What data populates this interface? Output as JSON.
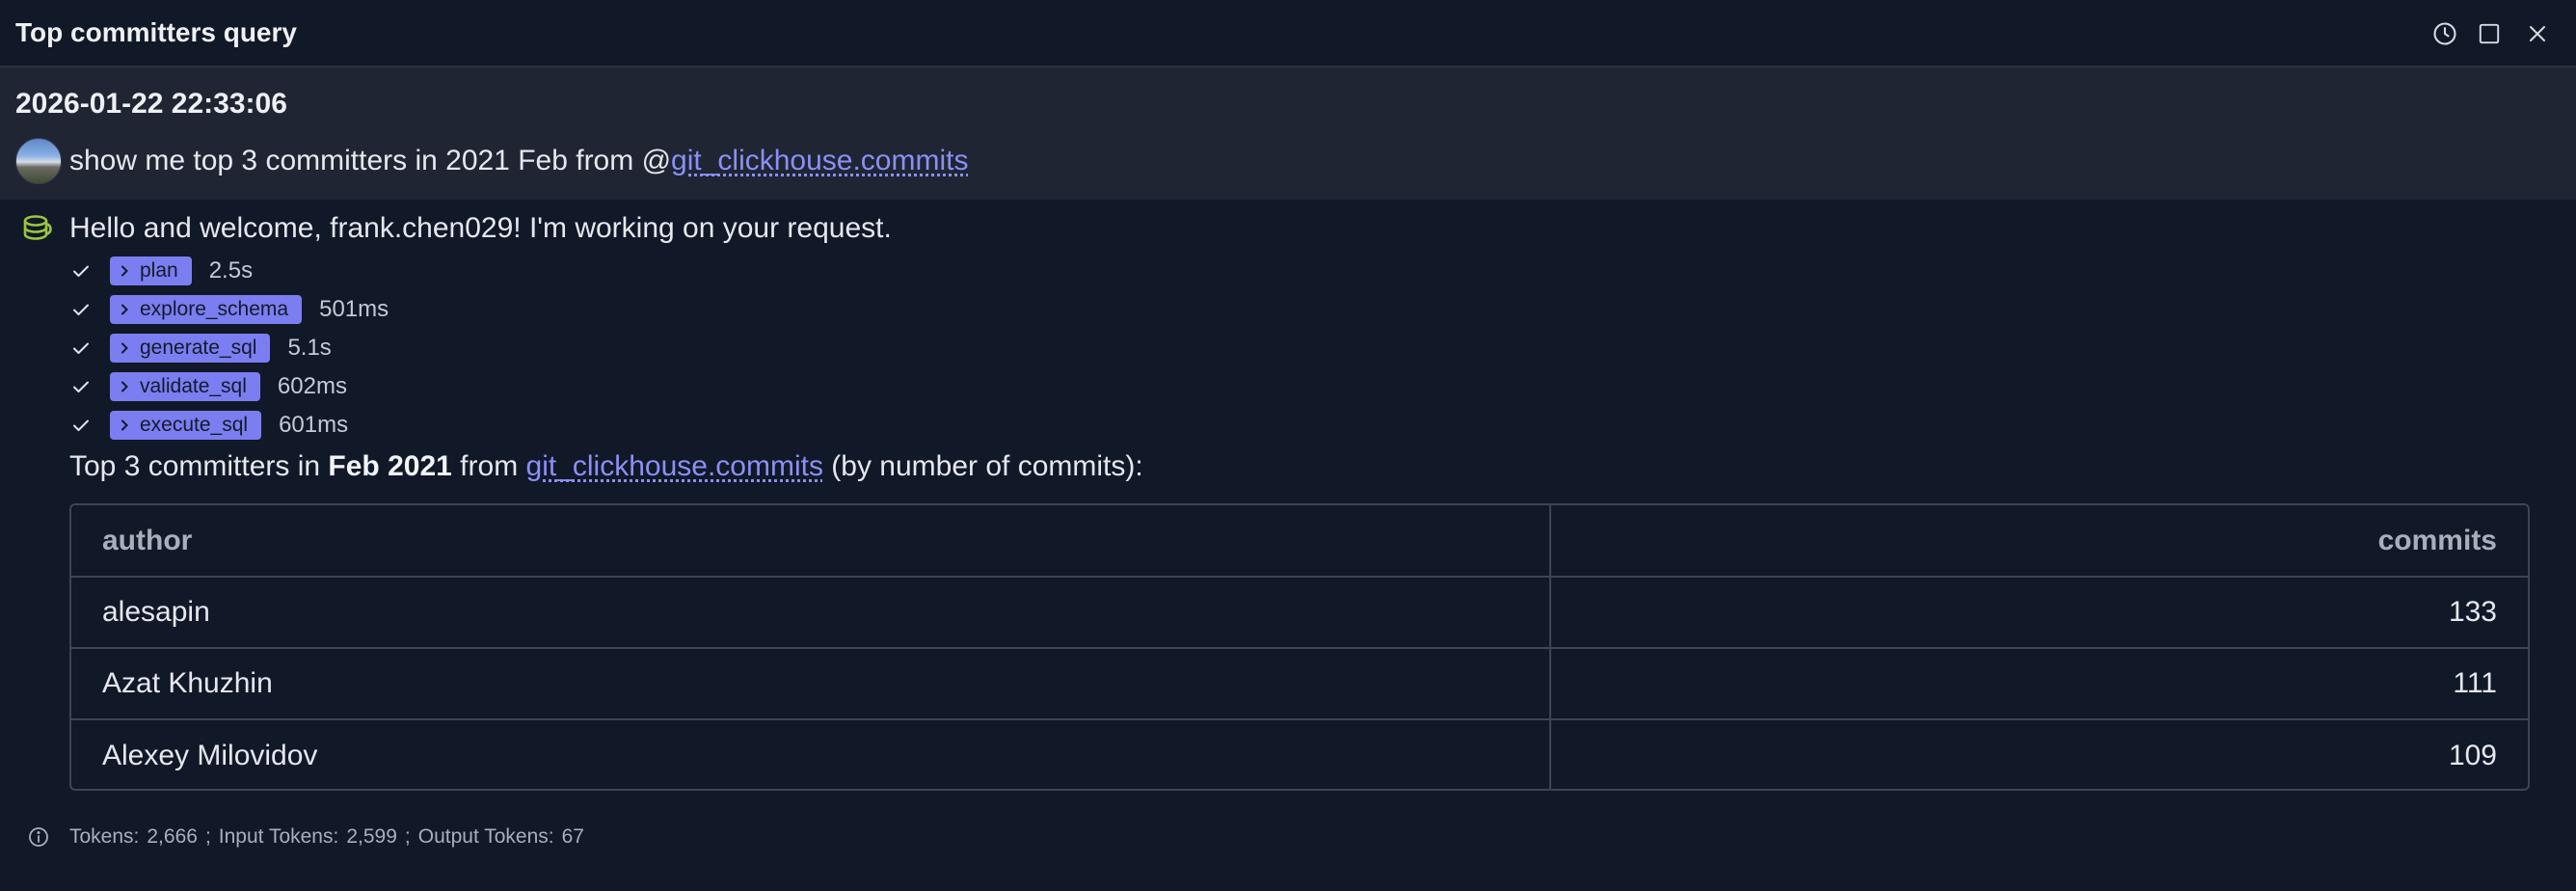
{
  "window": {
    "title": "Top committers query"
  },
  "conversation": {
    "timestamp": "2026-01-22 22:33:06",
    "user_message": {
      "prefix": "show me top 3 committers in 2021 Feb from @",
      "link": "git_clickhouse.commits"
    },
    "greeting": "Hello and welcome, frank.chen029! I'm working on your request."
  },
  "steps": [
    {
      "name": "plan",
      "duration": "2.5s"
    },
    {
      "name": "explore_schema",
      "duration": "501ms"
    },
    {
      "name": "generate_sql",
      "duration": "5.1s"
    },
    {
      "name": "validate_sql",
      "duration": "602ms"
    },
    {
      "name": "execute_sql",
      "duration": "601ms"
    }
  ],
  "summary": {
    "part1": "Top 3 committers in ",
    "bold": "Feb 2021",
    "part2": " from ",
    "link": "git_clickhouse.commits",
    "part3": " (by number of commits):"
  },
  "table": {
    "columns": [
      "author",
      "commits"
    ],
    "rows": [
      [
        "alesapin",
        "133"
      ],
      [
        "Azat Khuzhin",
        "111"
      ],
      [
        "Alexey Milovidov",
        "109"
      ]
    ]
  },
  "footer": {
    "tokens_label": "Tokens:",
    "tokens": "2,666",
    "input_label": "Input Tokens:",
    "input_tokens": "2,599",
    "output_label": "Output Tokens:",
    "output_tokens": "67",
    "separator": ";"
  },
  "icons": {
    "history": "clock-icon",
    "maximize": "square-icon",
    "close": "close-icon",
    "assistant": "database-icon",
    "step_done": "check-icon",
    "chip": "chevron-right-icon",
    "info": "info-icon"
  },
  "colors": {
    "background": "#111828",
    "user_block": "#1f2533",
    "chip": "#7a7ef0",
    "link": "#8c8ff5",
    "assistant_icon": "#9bc53d"
  }
}
